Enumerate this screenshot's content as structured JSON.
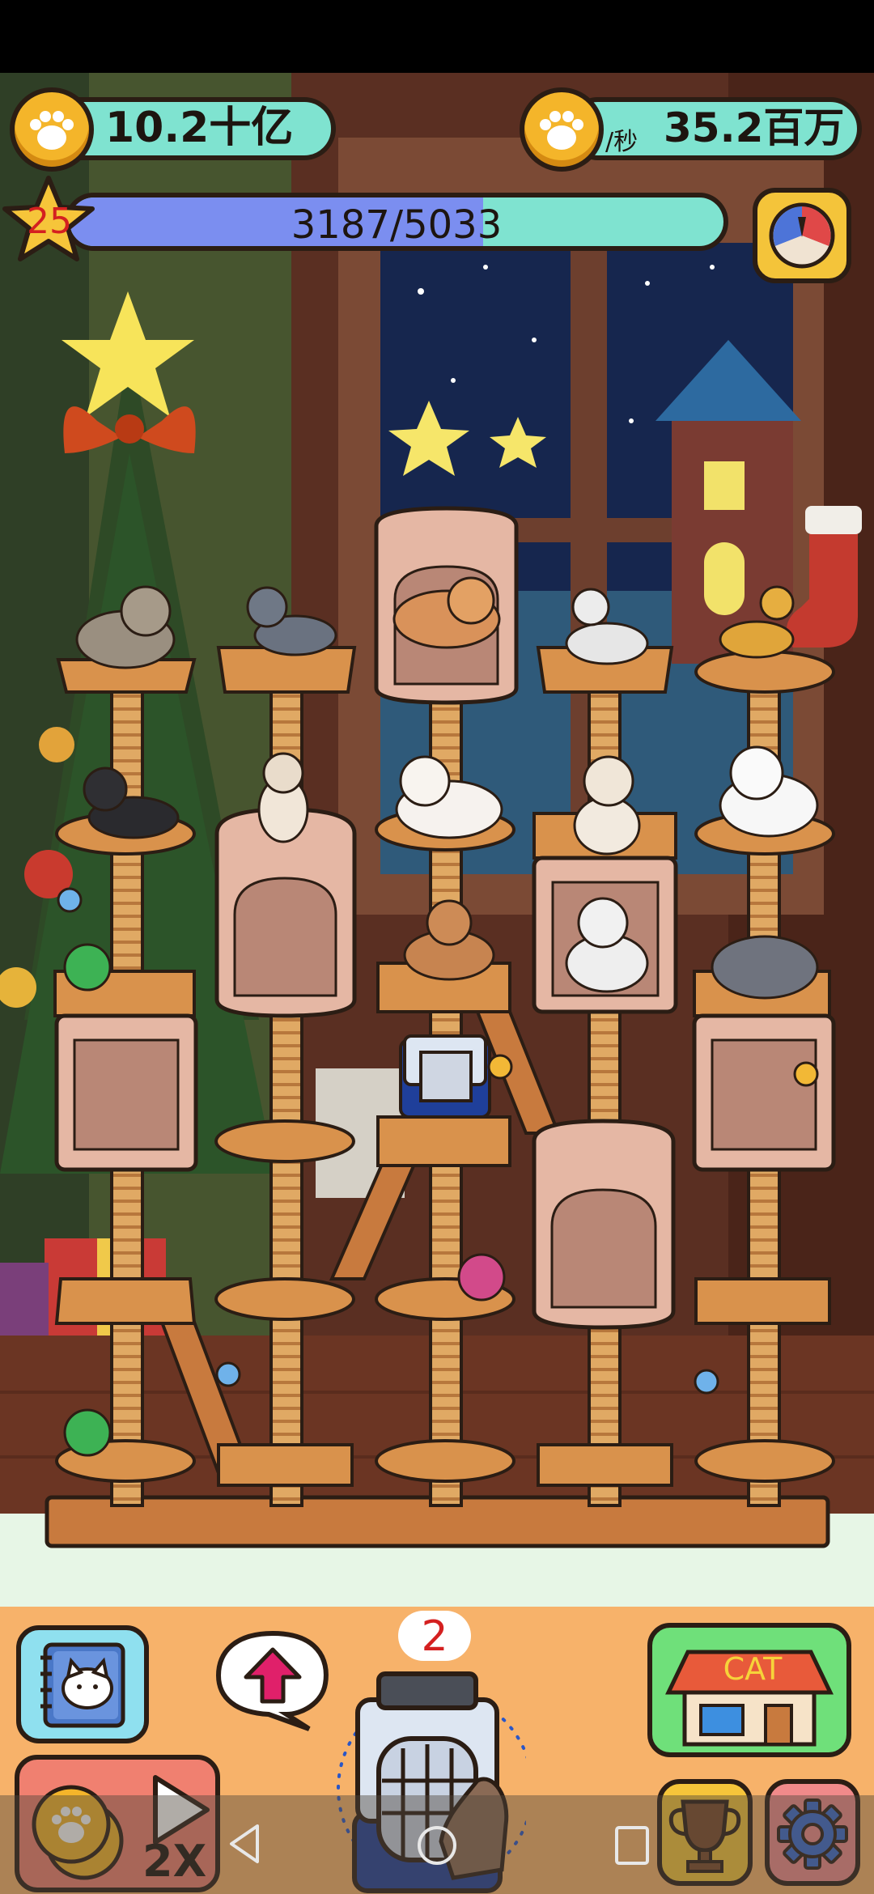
{
  "hud": {
    "coins": "10.2十亿",
    "rate_prefix": "/秒",
    "rate": "35.2百万",
    "level": "25",
    "xp_text": "3187/5033",
    "xp_progress": 0.633
  },
  "carrier": {
    "badge_count": "2"
  },
  "boost": {
    "label": "2X"
  },
  "shop": {
    "sign": "CAT"
  },
  "icons": {
    "coin": "paw-coin-icon",
    "star": "level-star-icon",
    "wheel": "lucky-wheel-icon",
    "book": "cat-book-icon",
    "arrow": "upgrade-arrow-icon",
    "trophy": "trophy-icon",
    "gear": "settings-gear-icon"
  },
  "colors": {
    "pill": "#7fe3d0",
    "xp_fill": "#7b8ef0",
    "coin": "#f4b52a",
    "bottom_panel": "#f7b26a",
    "outline": "#2b1d14"
  }
}
